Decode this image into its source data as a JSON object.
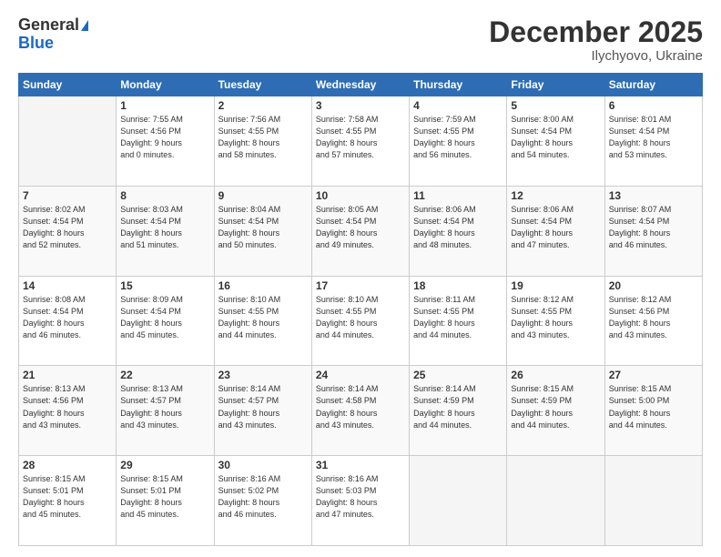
{
  "header": {
    "logo_general": "General",
    "logo_blue": "Blue",
    "month": "December 2025",
    "location": "Ilychyovo, Ukraine"
  },
  "days_of_week": [
    "Sunday",
    "Monday",
    "Tuesday",
    "Wednesday",
    "Thursday",
    "Friday",
    "Saturday"
  ],
  "weeks": [
    [
      {
        "day": "",
        "info": ""
      },
      {
        "day": "1",
        "info": "Sunrise: 7:55 AM\nSunset: 4:56 PM\nDaylight: 9 hours\nand 0 minutes."
      },
      {
        "day": "2",
        "info": "Sunrise: 7:56 AM\nSunset: 4:55 PM\nDaylight: 8 hours\nand 58 minutes."
      },
      {
        "day": "3",
        "info": "Sunrise: 7:58 AM\nSunset: 4:55 PM\nDaylight: 8 hours\nand 57 minutes."
      },
      {
        "day": "4",
        "info": "Sunrise: 7:59 AM\nSunset: 4:55 PM\nDaylight: 8 hours\nand 56 minutes."
      },
      {
        "day": "5",
        "info": "Sunrise: 8:00 AM\nSunset: 4:54 PM\nDaylight: 8 hours\nand 54 minutes."
      },
      {
        "day": "6",
        "info": "Sunrise: 8:01 AM\nSunset: 4:54 PM\nDaylight: 8 hours\nand 53 minutes."
      }
    ],
    [
      {
        "day": "7",
        "info": "Sunrise: 8:02 AM\nSunset: 4:54 PM\nDaylight: 8 hours\nand 52 minutes."
      },
      {
        "day": "8",
        "info": "Sunrise: 8:03 AM\nSunset: 4:54 PM\nDaylight: 8 hours\nand 51 minutes."
      },
      {
        "day": "9",
        "info": "Sunrise: 8:04 AM\nSunset: 4:54 PM\nDaylight: 8 hours\nand 50 minutes."
      },
      {
        "day": "10",
        "info": "Sunrise: 8:05 AM\nSunset: 4:54 PM\nDaylight: 8 hours\nand 49 minutes."
      },
      {
        "day": "11",
        "info": "Sunrise: 8:06 AM\nSunset: 4:54 PM\nDaylight: 8 hours\nand 48 minutes."
      },
      {
        "day": "12",
        "info": "Sunrise: 8:06 AM\nSunset: 4:54 PM\nDaylight: 8 hours\nand 47 minutes."
      },
      {
        "day": "13",
        "info": "Sunrise: 8:07 AM\nSunset: 4:54 PM\nDaylight: 8 hours\nand 46 minutes."
      }
    ],
    [
      {
        "day": "14",
        "info": "Sunrise: 8:08 AM\nSunset: 4:54 PM\nDaylight: 8 hours\nand 46 minutes."
      },
      {
        "day": "15",
        "info": "Sunrise: 8:09 AM\nSunset: 4:54 PM\nDaylight: 8 hours\nand 45 minutes."
      },
      {
        "day": "16",
        "info": "Sunrise: 8:10 AM\nSunset: 4:55 PM\nDaylight: 8 hours\nand 44 minutes."
      },
      {
        "day": "17",
        "info": "Sunrise: 8:10 AM\nSunset: 4:55 PM\nDaylight: 8 hours\nand 44 minutes."
      },
      {
        "day": "18",
        "info": "Sunrise: 8:11 AM\nSunset: 4:55 PM\nDaylight: 8 hours\nand 44 minutes."
      },
      {
        "day": "19",
        "info": "Sunrise: 8:12 AM\nSunset: 4:55 PM\nDaylight: 8 hours\nand 43 minutes."
      },
      {
        "day": "20",
        "info": "Sunrise: 8:12 AM\nSunset: 4:56 PM\nDaylight: 8 hours\nand 43 minutes."
      }
    ],
    [
      {
        "day": "21",
        "info": "Sunrise: 8:13 AM\nSunset: 4:56 PM\nDaylight: 8 hours\nand 43 minutes."
      },
      {
        "day": "22",
        "info": "Sunrise: 8:13 AM\nSunset: 4:57 PM\nDaylight: 8 hours\nand 43 minutes."
      },
      {
        "day": "23",
        "info": "Sunrise: 8:14 AM\nSunset: 4:57 PM\nDaylight: 8 hours\nand 43 minutes."
      },
      {
        "day": "24",
        "info": "Sunrise: 8:14 AM\nSunset: 4:58 PM\nDaylight: 8 hours\nand 43 minutes."
      },
      {
        "day": "25",
        "info": "Sunrise: 8:14 AM\nSunset: 4:59 PM\nDaylight: 8 hours\nand 44 minutes."
      },
      {
        "day": "26",
        "info": "Sunrise: 8:15 AM\nSunset: 4:59 PM\nDaylight: 8 hours\nand 44 minutes."
      },
      {
        "day": "27",
        "info": "Sunrise: 8:15 AM\nSunset: 5:00 PM\nDaylight: 8 hours\nand 44 minutes."
      }
    ],
    [
      {
        "day": "28",
        "info": "Sunrise: 8:15 AM\nSunset: 5:01 PM\nDaylight: 8 hours\nand 45 minutes."
      },
      {
        "day": "29",
        "info": "Sunrise: 8:15 AM\nSunset: 5:01 PM\nDaylight: 8 hours\nand 45 minutes."
      },
      {
        "day": "30",
        "info": "Sunrise: 8:16 AM\nSunset: 5:02 PM\nDaylight: 8 hours\nand 46 minutes."
      },
      {
        "day": "31",
        "info": "Sunrise: 8:16 AM\nSunset: 5:03 PM\nDaylight: 8 hours\nand 47 minutes."
      },
      {
        "day": "",
        "info": ""
      },
      {
        "day": "",
        "info": ""
      },
      {
        "day": "",
        "info": ""
      }
    ]
  ]
}
